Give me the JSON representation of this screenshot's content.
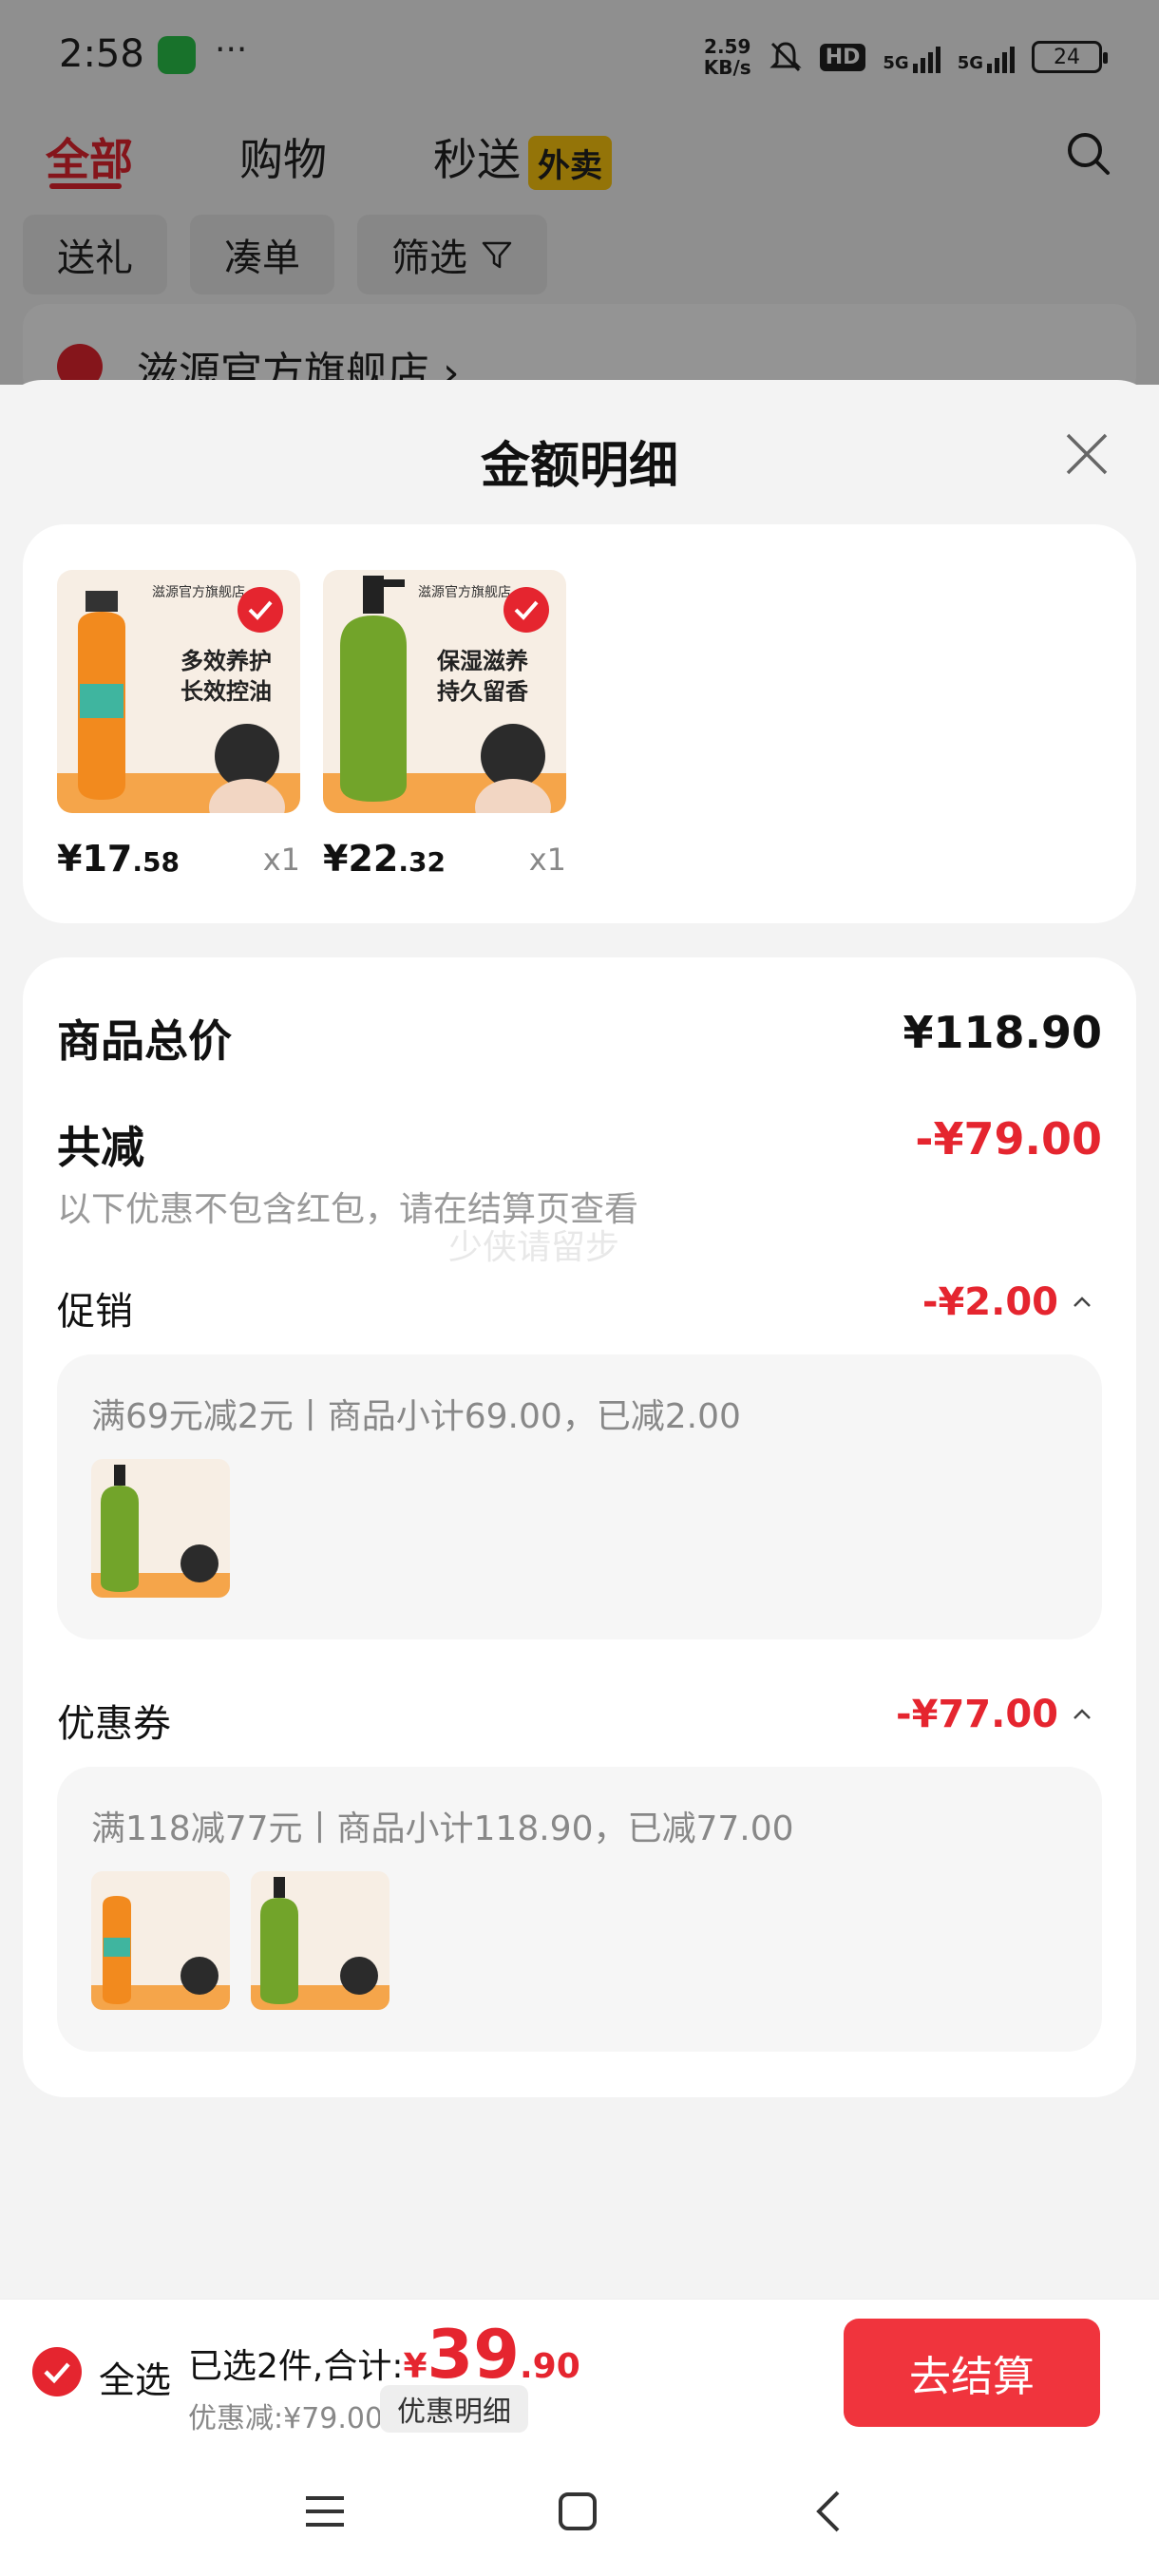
{
  "status_bar": {
    "time": "2:58",
    "net_speed_value": "2.59",
    "net_speed_unit": "KB/s",
    "hd_label": "HD",
    "signal1_label": "5G",
    "signal2_label": "5G",
    "battery": "24",
    "icons": [
      "wechat-icon",
      "mute-icon",
      "signal-icon",
      "battery-icon"
    ]
  },
  "background_page": {
    "tabs": [
      {
        "label": "全部",
        "active": true
      },
      {
        "label": "购物",
        "active": false
      },
      {
        "label": "秒送",
        "active": false
      }
    ],
    "tab_badge": "外卖",
    "chips": [
      "送礼",
      "凑单",
      "筛选"
    ],
    "store_name": "滋源官方旗舰店 ›"
  },
  "sheet": {
    "title": "金额明细",
    "products": [
      {
        "price_int": "¥17",
        "price_dec": ".58",
        "qty": "x1",
        "theme": "orange",
        "tagline_1": "多效养护",
        "tagline_2": "长效控油",
        "store": "滋源官方旗舰店"
      },
      {
        "price_int": "¥22",
        "price_dec": ".32",
        "qty": "x1",
        "theme": "green",
        "tagline_1": "保湿滋养",
        "tagline_2": "持久留香",
        "store": "滋源官方旗舰店"
      }
    ],
    "summary": {
      "total_label": "商品总价",
      "total_value": "¥118.90",
      "reduce_label": "共减",
      "reduce_value": "-¥79.00",
      "note": "以下优惠不包含红包，请在结算页查看",
      "watermark": "少侠请留步"
    },
    "promo": {
      "label": "促销",
      "value": "-¥2.00",
      "detail": "满69元减2元丨商品小计69.00，已减2.00"
    },
    "coupon": {
      "label": "优惠券",
      "value": "-¥77.00",
      "detail": "满118减77元丨商品小计118.90，已减77.00"
    }
  },
  "bottom_bar": {
    "select_all": "全选",
    "selected_text": "已选2件,合计:",
    "total_yen": "¥",
    "total_int": "39",
    "total_dec": ".90",
    "discount_text": "优惠减:¥79.00",
    "detail_button": "优惠明细",
    "checkout_button": "去结算"
  },
  "colors": {
    "accent": "#e5252f",
    "checkout": "#f0343d",
    "badge": "#ffc90e"
  }
}
